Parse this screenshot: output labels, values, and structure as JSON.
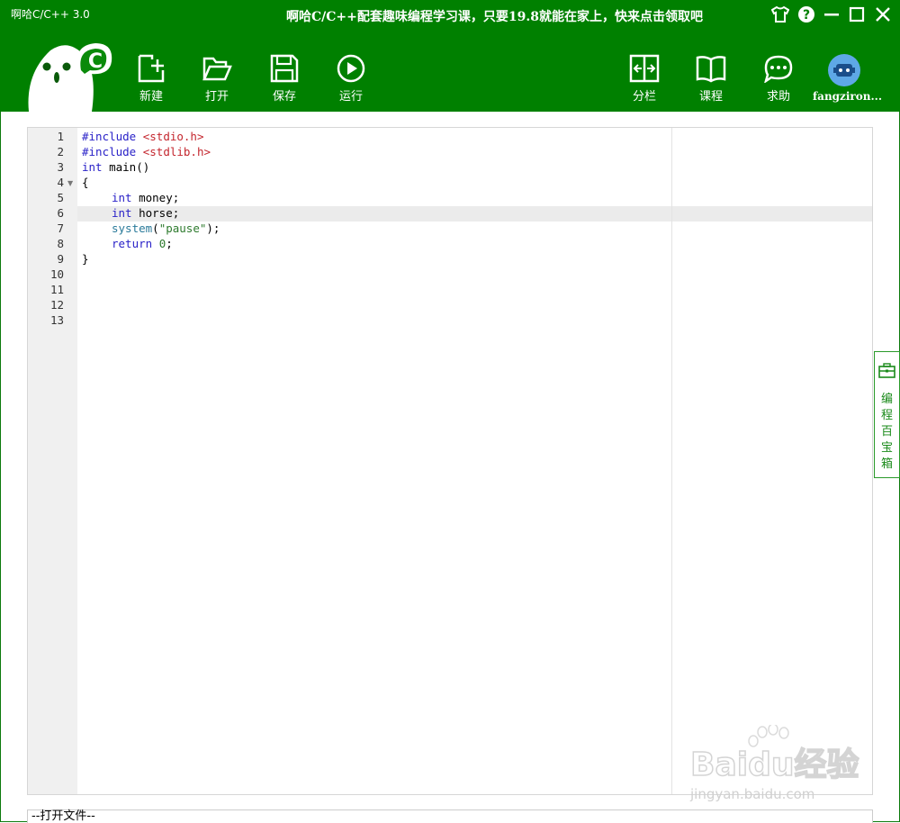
{
  "window": {
    "title": "啊哈C/C++ 3.0",
    "promo": "啊哈C/C++配套趣味编程学习课，只要19.8就能在家上，快来点击领取吧"
  },
  "colors": {
    "brand": "#008000",
    "accent_tab": "#1a8a1a"
  },
  "toolbar": {
    "new_label": "新建",
    "open_label": "打开",
    "save_label": "保存",
    "run_label": "运行",
    "split_label": "分栏",
    "course_label": "课程",
    "help_label": "求助",
    "user_label": "fangziron..."
  },
  "editor": {
    "line_numbers": [
      "1",
      "2",
      "3",
      "4",
      "5",
      "6",
      "7",
      "8",
      "9",
      "10",
      "11",
      "12",
      "13"
    ],
    "lines": {
      "l1_dir": "#include",
      "l1_hdr": "<stdio.h>",
      "l2_dir": "#include",
      "l2_hdr": "<stdlib.h>",
      "l3_type": "int",
      "l3_rest": " main()",
      "l4": "{",
      "l5_type": "int",
      "l5_rest": " money;",
      "l6_type": "int",
      "l6_rest": " horse;",
      "l7_fn": "system",
      "l7_open": "(",
      "l7_str": "\"pause\"",
      "l7_close": ");",
      "l8_kw": "return",
      "l8_space": " ",
      "l8_num": "0",
      "l8_end": ";",
      "l9": "}"
    }
  },
  "side_panel": {
    "label_chars": [
      "编",
      "程",
      "百",
      "宝",
      "箱"
    ]
  },
  "status_bar": {
    "text": "--打开文件--"
  },
  "watermark": {
    "brand": "Baidu经验",
    "url": "jingyan.baidu.com"
  }
}
